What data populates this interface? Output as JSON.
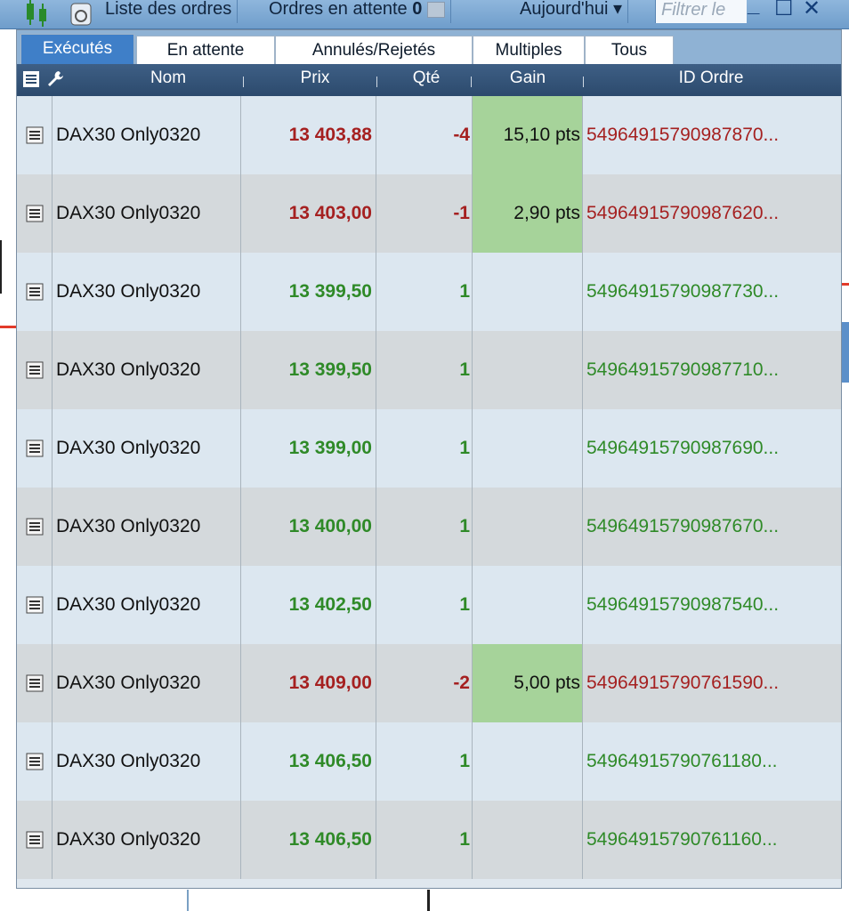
{
  "toolbar": {
    "orders_list_label": "Liste des ordres",
    "pending_label": "Ordres en attente",
    "pending_count": "0",
    "today_label": "Aujourd'hui ▾",
    "filter_placeholder": "Filtrer le",
    "window_controls": [
      "_",
      "☐",
      "✕"
    ]
  },
  "tabs": [
    {
      "label": "Exécutés",
      "active": true
    },
    {
      "label": "En attente",
      "active": false
    },
    {
      "label": "Annulés/Rejetés",
      "active": false
    },
    {
      "label": "Multiples",
      "active": false
    },
    {
      "label": "Tous",
      "active": false
    }
  ],
  "columns": {
    "name": "Nom",
    "price": "Prix",
    "qty": "Qté",
    "gain": "Gain",
    "order_id": "ID Ordre"
  },
  "rows": [
    {
      "name": "DAX30 Only0320",
      "price": "13 403,88",
      "qty": "-4",
      "gain": "15,10 pts",
      "order_id": "54964915790987870..."
    },
    {
      "name": "DAX30 Only0320",
      "price": "13 403,00",
      "qty": "-1",
      "gain": "2,90 pts",
      "order_id": "54964915790987620..."
    },
    {
      "name": "DAX30 Only0320",
      "price": "13 399,50",
      "qty": "1",
      "gain": "",
      "order_id": "54964915790987730..."
    },
    {
      "name": "DAX30 Only0320",
      "price": "13 399,50",
      "qty": "1",
      "gain": "",
      "order_id": "54964915790987710..."
    },
    {
      "name": "DAX30 Only0320",
      "price": "13 399,00",
      "qty": "1",
      "gain": "",
      "order_id": "54964915790987690..."
    },
    {
      "name": "DAX30 Only0320",
      "price": "13 400,00",
      "qty": "1",
      "gain": "",
      "order_id": "54964915790987670..."
    },
    {
      "name": "DAX30 Only0320",
      "price": "13 402,50",
      "qty": "1",
      "gain": "",
      "order_id": "54964915790987540..."
    },
    {
      "name": "DAX30 Only0320",
      "price": "13 409,00",
      "qty": "-2",
      "gain": "5,00 pts",
      "order_id": "54964915790761590..."
    },
    {
      "name": "DAX30 Only0320",
      "price": "13 406,50",
      "qty": "1",
      "gain": "",
      "order_id": "54964915790761180..."
    },
    {
      "name": "DAX30 Only0320",
      "price": "13 406,50",
      "qty": "1",
      "gain": "",
      "order_id": "54964915790761160..."
    }
  ],
  "colors": {
    "sell": "#a52020",
    "buy": "#2f8a28",
    "gain_highlight": "#a6d39a",
    "active_tab": "#3f7fc8",
    "header": "#2c4a6d"
  }
}
